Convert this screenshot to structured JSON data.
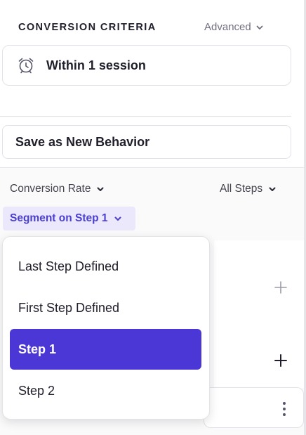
{
  "criteria": {
    "title": "CONVERSION CRITERIA",
    "advanced_label": "Advanced",
    "session_label": "Within 1 session",
    "session_icon": "alarm-clock-icon"
  },
  "save_label": "Save as New Behavior",
  "metrics": {
    "conversion_rate_label": "Conversion Rate",
    "all_steps_label": "All Steps",
    "segment_label": "Segment on Step 1"
  },
  "dropdown": {
    "options": [
      {
        "label": "Last Step Defined",
        "selected": false
      },
      {
        "label": "First Step Defined",
        "selected": false
      },
      {
        "label": "Step 1",
        "selected": true
      },
      {
        "label": "Step 2",
        "selected": false
      }
    ]
  },
  "colors": {
    "accent": "#4b36d6",
    "segment_bg": "#ebe8fb",
    "segment_text": "#4a3fd1"
  }
}
